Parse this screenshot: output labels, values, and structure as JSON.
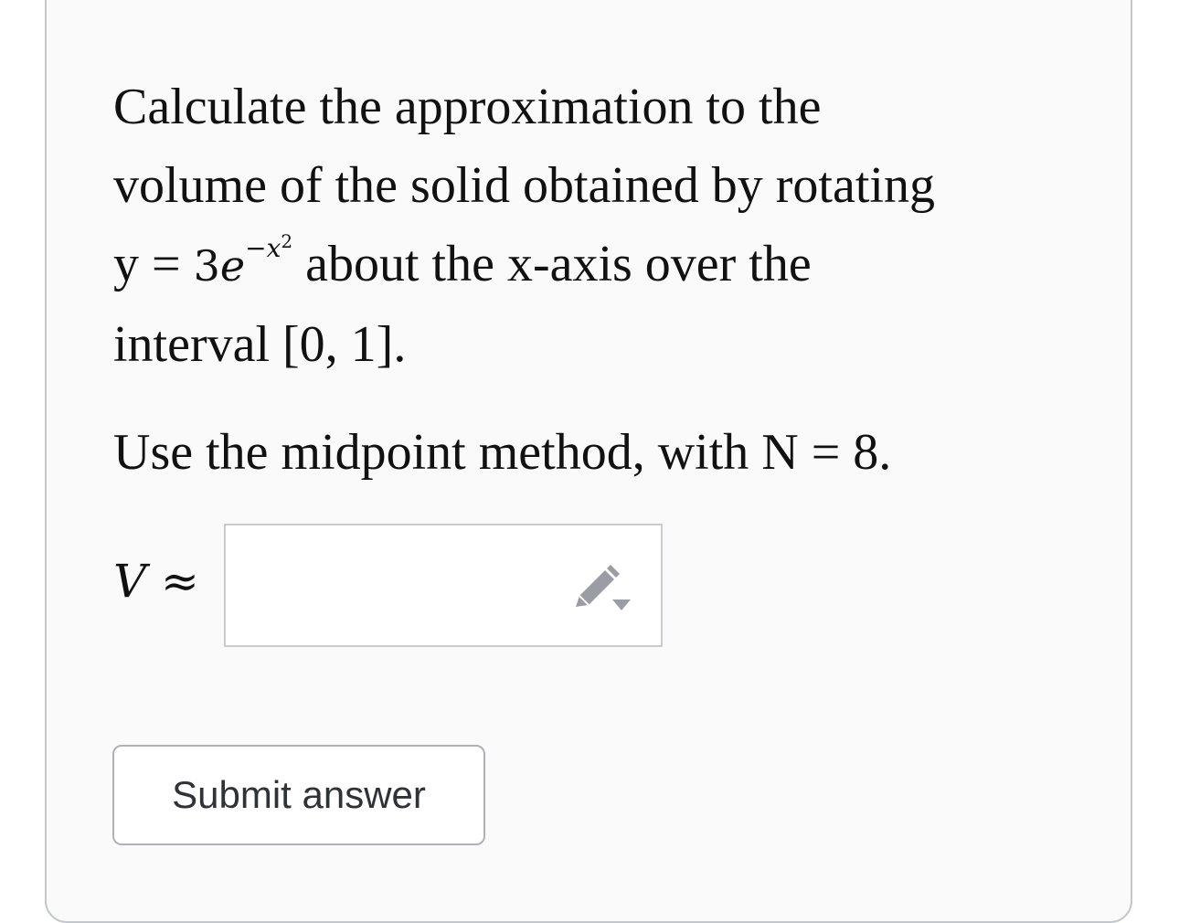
{
  "question": {
    "line1": "Calculate the approximation to the",
    "line2": "volume of the solid obtained by rotating",
    "line3_prefix": "y = ",
    "line3_coef": "3",
    "line3_base": "e",
    "line3_exp_minus": "−",
    "line3_exp_var": "x",
    "line3_exp_pow": "2",
    "line3_suffix": "about the x-axis over the",
    "line4": "interval [0, 1]."
  },
  "instruction": "Use the midpoint method, with N = 8.",
  "answer": {
    "variable": "V",
    "symbol": "≈",
    "value": "",
    "edit_icon": "pencil-dropdown-icon"
  },
  "submit_label": "Submit answer",
  "colors": {
    "card_background": "#fafafa",
    "card_border": "#c4c7cc",
    "text": "#111111",
    "button_text": "#2f3338",
    "icon": "#9a9ea4"
  }
}
